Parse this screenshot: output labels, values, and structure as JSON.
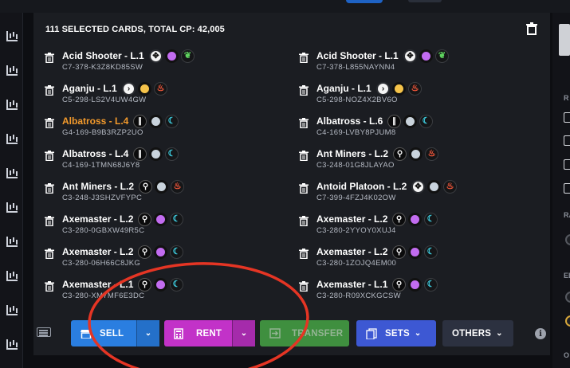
{
  "header": {
    "title": "111 SELECTED CARDS, TOTAL CP: 42,005"
  },
  "cards_left": [
    {
      "name": "Acid Shooter - L.1",
      "code": "C7-378-K3Z8KD85SW",
      "rare": false,
      "icons": [
        {
          "kind": "type",
          "glyph": "✥"
        },
        {
          "kind": "dot",
          "color": "#c26cf0"
        },
        {
          "kind": "elem",
          "glyph": "❦",
          "color": "#5fd35f",
          "fill": "#5fd35f"
        }
      ]
    },
    {
      "name": "Aganju - L.1",
      "code": "C5-298-LS2V4UW4GW",
      "rare": false,
      "icons": [
        {
          "kind": "type",
          "glyph": "›"
        },
        {
          "kind": "dot",
          "color": "#f5c34a"
        },
        {
          "kind": "elem",
          "glyph": "♨",
          "color": "#ff5a3c"
        }
      ]
    },
    {
      "name": "Albatross - L.4",
      "code": "G4-169-B9B3RZP2UO",
      "rare": true,
      "icons": [
        {
          "kind": "type-dark",
          "glyph": "∥"
        },
        {
          "kind": "dot",
          "color": "#c9d3dc"
        },
        {
          "kind": "elem",
          "glyph": "☾",
          "color": "#3fd3e6"
        }
      ]
    },
    {
      "name": "Albatross - L.4",
      "code": "C4-169-1TMN68J6Y8",
      "rare": false,
      "icons": [
        {
          "kind": "type-dark",
          "glyph": "∥"
        },
        {
          "kind": "dot",
          "color": "#c9d3dc"
        },
        {
          "kind": "elem",
          "glyph": "☾",
          "color": "#3fd3e6"
        }
      ]
    },
    {
      "name": "Ant Miners - L.2",
      "code": "C3-248-J3SHZVFYPC",
      "rare": false,
      "icons": [
        {
          "kind": "type-dark",
          "glyph": "⚲"
        },
        {
          "kind": "dot",
          "color": "#c9d3dc"
        },
        {
          "kind": "elem",
          "glyph": "♨",
          "color": "#ff5a3c"
        }
      ]
    },
    {
      "name": "Axemaster - L.2",
      "code": "C3-280-0GBXW49R5C",
      "rare": false,
      "icons": [
        {
          "kind": "type-dark",
          "glyph": "⚲"
        },
        {
          "kind": "dot",
          "color": "#c26cf0"
        },
        {
          "kind": "elem",
          "glyph": "☾",
          "color": "#3fd3e6"
        }
      ]
    },
    {
      "name": "Axemaster - L.2",
      "code": "C3-280-06H66C8JKG",
      "rare": false,
      "icons": [
        {
          "kind": "type-dark",
          "glyph": "⚲"
        },
        {
          "kind": "dot",
          "color": "#c26cf0"
        },
        {
          "kind": "elem",
          "glyph": "☾",
          "color": "#3fd3e6"
        }
      ]
    },
    {
      "name": "Axemaster - L.1",
      "code": "C3-280-XM7MF6E3DC",
      "rare": false,
      "icons": [
        {
          "kind": "type-dark",
          "glyph": "⚲"
        },
        {
          "kind": "dot",
          "color": "#c26cf0"
        },
        {
          "kind": "elem",
          "glyph": "☾",
          "color": "#3fd3e6"
        }
      ]
    }
  ],
  "cards_right": [
    {
      "name": "Acid Shooter - L.1",
      "code": "C7-378-L855NAYNN4",
      "rare": false,
      "icons": [
        {
          "kind": "type",
          "glyph": "✥"
        },
        {
          "kind": "dot",
          "color": "#c26cf0"
        },
        {
          "kind": "elem",
          "glyph": "❦",
          "color": "#5fd35f",
          "fill": "#5fd35f"
        }
      ]
    },
    {
      "name": "Aganju - L.1",
      "code": "C5-298-NOZ4X2BV6O",
      "rare": false,
      "icons": [
        {
          "kind": "type",
          "glyph": "›"
        },
        {
          "kind": "dot",
          "color": "#f5c34a"
        },
        {
          "kind": "elem",
          "glyph": "♨",
          "color": "#ff5a3c"
        }
      ]
    },
    {
      "name": "Albatross - L.6",
      "code": "C4-169-LVBY8PJUM8",
      "rare": false,
      "icons": [
        {
          "kind": "type-dark",
          "glyph": "∥"
        },
        {
          "kind": "dot",
          "color": "#c9d3dc"
        },
        {
          "kind": "elem",
          "glyph": "☾",
          "color": "#3fd3e6"
        }
      ]
    },
    {
      "name": "Ant Miners - L.2",
      "code": "C3-248-01G8JLAYAO",
      "rare": false,
      "icons": [
        {
          "kind": "type-dark",
          "glyph": "⚲"
        },
        {
          "kind": "dot",
          "color": "#c9d3dc"
        },
        {
          "kind": "elem",
          "glyph": "♨",
          "color": "#ff5a3c"
        }
      ]
    },
    {
      "name": "Antoid Platoon - L.2",
      "code": "C7-399-4FZJ4K02OW",
      "rare": false,
      "icons": [
        {
          "kind": "type",
          "glyph": "✥"
        },
        {
          "kind": "dot",
          "color": "#c9d3dc"
        },
        {
          "kind": "elem",
          "glyph": "♨",
          "color": "#ff5a3c"
        }
      ]
    },
    {
      "name": "Axemaster - L.2",
      "code": "C3-280-2YYOY0XUJ4",
      "rare": false,
      "icons": [
        {
          "kind": "type-dark",
          "glyph": "⚲"
        },
        {
          "kind": "dot",
          "color": "#c26cf0"
        },
        {
          "kind": "elem",
          "glyph": "☾",
          "color": "#3fd3e6"
        }
      ]
    },
    {
      "name": "Axemaster - L.2",
      "code": "C3-280-1ZOJQ4EM00",
      "rare": false,
      "icons": [
        {
          "kind": "type-dark",
          "glyph": "⚲"
        },
        {
          "kind": "dot",
          "color": "#c26cf0"
        },
        {
          "kind": "elem",
          "glyph": "☾",
          "color": "#3fd3e6"
        }
      ]
    },
    {
      "name": "Axemaster - L.1",
      "code": "C3-280-R09XCKGCSW",
      "rare": false,
      "icons": [
        {
          "kind": "type-dark",
          "glyph": "⚲"
        },
        {
          "kind": "dot",
          "color": "#c26cf0"
        },
        {
          "kind": "elem",
          "glyph": "☾",
          "color": "#3fd3e6"
        }
      ]
    }
  ],
  "toolbar": {
    "sell_label": "SELL",
    "rent_label": "RENT",
    "transfer_label": "TRANSFER",
    "sets_label": "SETS",
    "others_label": "OTHERS",
    "info_glyph": "i",
    "dropdown_glyph": "⌄"
  },
  "sidebar": {
    "labels": [
      "R",
      "RA",
      "EL",
      "O"
    ]
  },
  "colors": {
    "rare_name": "#f39a2c",
    "sell": "#2a7ee0",
    "rent": "#c232c8",
    "transfer": "#3f8f3f",
    "sets": "#3d58d3",
    "others": "#2c3140",
    "annotation": "#e53524"
  },
  "icons": {
    "rail": "chart-icon",
    "trash": "trash-icon",
    "keyboard": "keyboard-icon",
    "sell": "shop-icon",
    "rent": "calculator-icon",
    "transfer": "transfer-icon",
    "sets": "cards-stack-icon"
  }
}
